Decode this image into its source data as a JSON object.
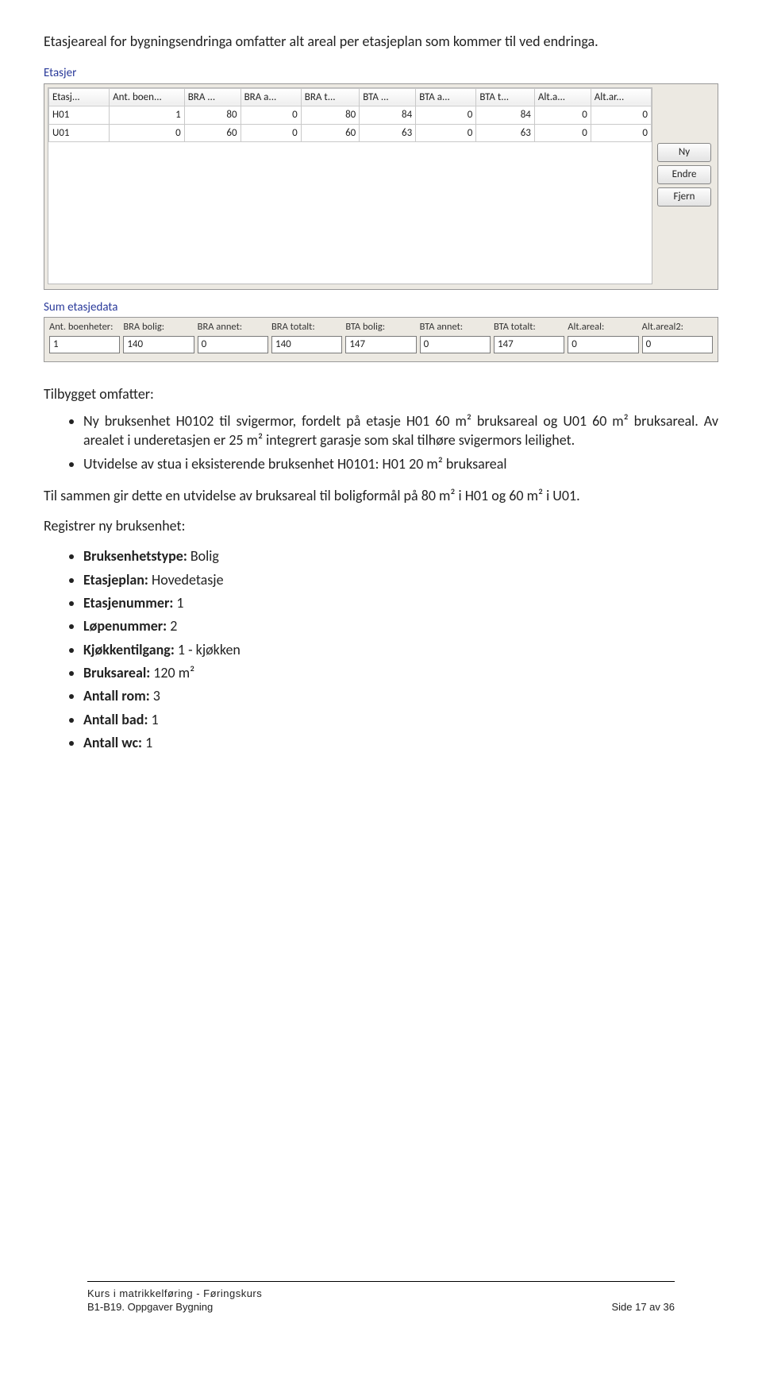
{
  "intro": "Etasjeareal for bygningsendringa omfatter alt areal per etasjeplan som kommer til ved endringa.",
  "etasjer": {
    "title": "Etasjer",
    "headers": [
      "Etasj...",
      "Ant. boen...",
      "BRA ...",
      "BRA a...",
      "BRA t...",
      "BTA ...",
      "BTA a...",
      "BTA t...",
      "Alt.a...",
      "Alt.ar..."
    ],
    "rows": [
      {
        "c": [
          "H01",
          "1",
          "80",
          "0",
          "80",
          "84",
          "0",
          "84",
          "0",
          "0"
        ]
      },
      {
        "c": [
          "U01",
          "0",
          "60",
          "0",
          "60",
          "63",
          "0",
          "63",
          "0",
          "0"
        ]
      }
    ],
    "buttons": {
      "ny": "Ny",
      "endre": "Endre",
      "fjern": "Fjern"
    }
  },
  "sum": {
    "title": "Sum etasjedata",
    "labels": [
      "Ant. boenheter:",
      "BRA bolig:",
      "BRA annet:",
      "BRA totalt:",
      "BTA bolig:",
      "BTA annet:",
      "BTA totalt:",
      "Alt.areal:",
      "Alt.areal2:"
    ],
    "values": [
      "1",
      "140",
      "0",
      "140",
      "147",
      "0",
      "147",
      "0",
      "0"
    ]
  },
  "tilbygget": {
    "heading": "Tilbygget omfatter:",
    "items": [
      "Ny bruksenhet H0102 til svigermor, fordelt på etasje H01 60 m² bruksareal og U01 60 m² bruksareal. Av arealet i underetasjen er 25 m² integrert garasje som skal tilhøre svigermors leilighet.",
      "Utvidelse av stua i eksisterende bruksenhet H0101: H01 20 m² bruksareal"
    ]
  },
  "summary": "Til sammen gir dette en utvidelse av bruksareal til boligformål på 80 m² i H01 og 60 m² i U01.",
  "register": {
    "heading": "Registrer ny bruksenhet:",
    "items": [
      {
        "label": "Bruksenhetstype:",
        "value": " Bolig"
      },
      {
        "label": "Etasjeplan:",
        "value": " Hovedetasje"
      },
      {
        "label": "Etasjenummer:",
        "value": " 1"
      },
      {
        "label": "Løpenummer:",
        "value": " 2"
      },
      {
        "label": "Kjøkkentilgang:",
        "value": " 1 - kjøkken"
      },
      {
        "label": "Bruksareal:",
        "value": " 120 m²"
      },
      {
        "label": "Antall rom:",
        "value": " 3"
      },
      {
        "label": "Antall bad:",
        "value": " 1"
      },
      {
        "label": "Antall wc:",
        "value": " 1"
      }
    ]
  },
  "footer": {
    "line1": "Kurs i matrikkelføring - Føringskurs",
    "left": "B1-B19. Oppgaver Bygning",
    "right": "Side 17 av 36"
  },
  "chart_data": [
    {
      "type": "table",
      "title": "Etasjer",
      "columns": [
        "Etasj",
        "Ant. boen",
        "BRA",
        "BRA a",
        "BRA t",
        "BTA",
        "BTA a",
        "BTA t",
        "Alt.a",
        "Alt.ar"
      ],
      "rows": [
        [
          "H01",
          1,
          80,
          0,
          80,
          84,
          0,
          84,
          0,
          0
        ],
        [
          "U01",
          0,
          60,
          0,
          60,
          63,
          0,
          63,
          0,
          0
        ]
      ]
    },
    {
      "type": "table",
      "title": "Sum etasjedata",
      "columns": [
        "Ant. boenheter",
        "BRA bolig",
        "BRA annet",
        "BRA totalt",
        "BTA bolig",
        "BTA annet",
        "BTA totalt",
        "Alt.areal",
        "Alt.areal2"
      ],
      "rows": [
        [
          1,
          140,
          0,
          140,
          147,
          0,
          147,
          0,
          0
        ]
      ]
    }
  ]
}
